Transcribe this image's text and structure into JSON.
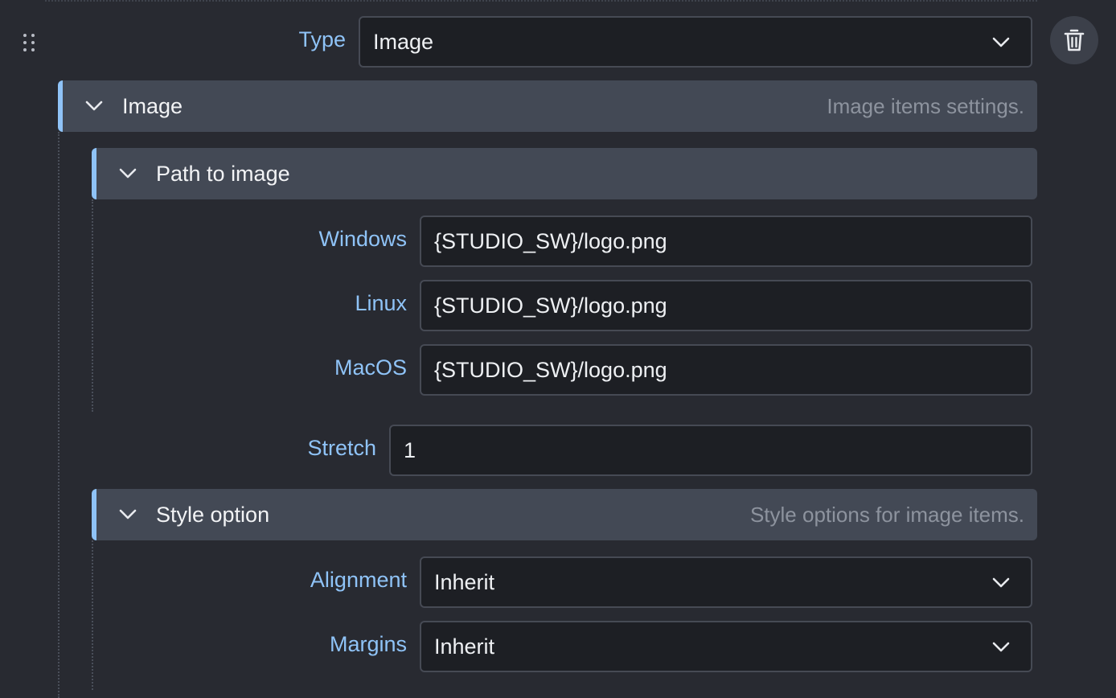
{
  "type_row": {
    "label": "Type",
    "value": "Image"
  },
  "image_section": {
    "title": "Image",
    "description": "Image items settings."
  },
  "path_section": {
    "title": "Path to image",
    "windows_label": "Windows",
    "windows_value": "{STUDIO_SW}/logo.png",
    "linux_label": "Linux",
    "linux_value": "{STUDIO_SW}/logo.png",
    "macos_label": "MacOS",
    "macos_value": "{STUDIO_SW}/logo.png"
  },
  "stretch_row": {
    "label": "Stretch",
    "value": "1"
  },
  "style_section": {
    "title": "Style option",
    "description": "Style options for image items.",
    "alignment_label": "Alignment",
    "alignment_value": "Inherit",
    "margins_label": "Margins",
    "margins_value": "Inherit"
  },
  "icons": [
    "drag-handle-icon",
    "chevron-down-icon",
    "trash-icon"
  ],
  "colors": {
    "background": "#282a31",
    "label": "#8fc3f7",
    "field_bg": "#1d1f24",
    "section_bg": "#434955",
    "accent": "#8fc3f7"
  }
}
